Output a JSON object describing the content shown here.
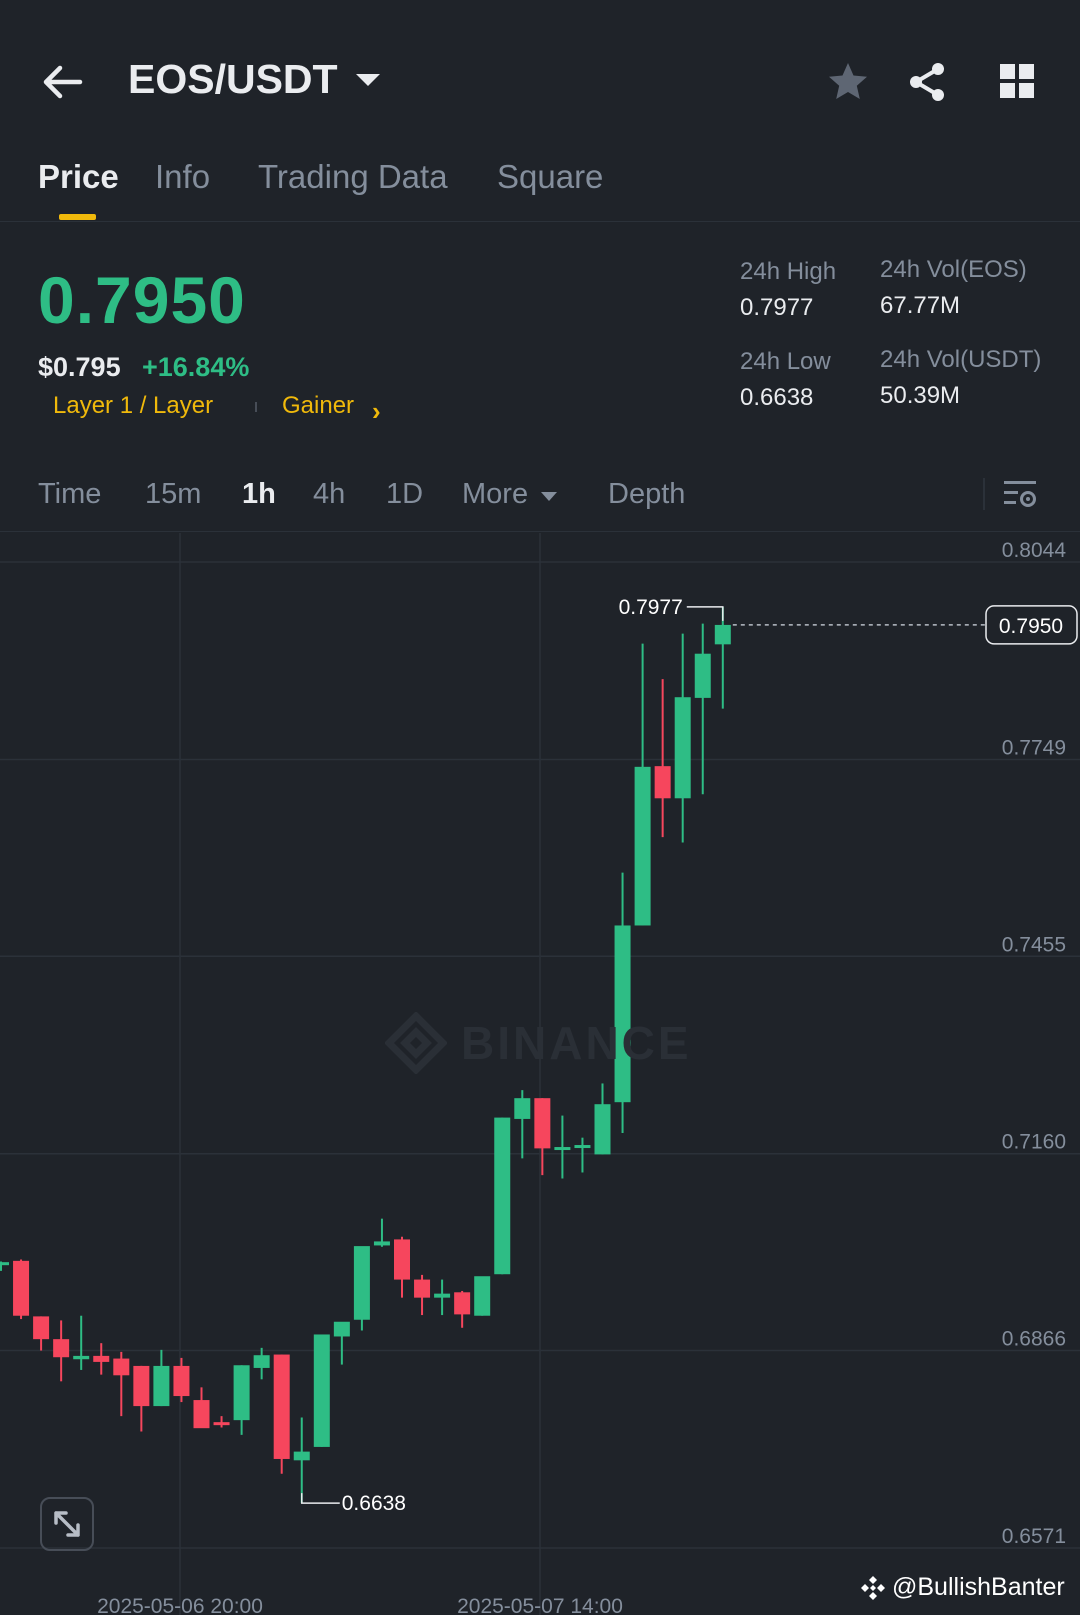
{
  "header": {
    "pair": "EOS/USDT"
  },
  "tabs": [
    {
      "label": "Price",
      "active": true
    },
    {
      "label": "Info",
      "active": false
    },
    {
      "label": "Trading Data",
      "active": false
    },
    {
      "label": "Square",
      "active": false
    }
  ],
  "ticker": {
    "last_price": "0.7950",
    "usd_price": "$0.795",
    "change_pct": "+16.84%",
    "tag_category": "Layer 1 / Layer",
    "tag_gainer": "Gainer",
    "high_label": "24h High",
    "high_value": "0.7977",
    "low_label": "24h Low",
    "low_value": "0.6638",
    "vol_base_label": "24h Vol(EOS)",
    "vol_base_value": "67.77M",
    "vol_quote_label": "24h Vol(USDT)",
    "vol_quote_value": "50.39M"
  },
  "intervals": {
    "time": "Time",
    "m15": "15m",
    "h1": "1h",
    "h4": "4h",
    "d1": "1D",
    "more": "More",
    "depth": "Depth",
    "active": "1h"
  },
  "colors": {
    "up": "#2ebd85",
    "down": "#f6465d",
    "accent": "#f0b90b",
    "background": "#1f2329"
  },
  "chart_data": {
    "type": "candlestick",
    "y_ticks": [
      "0.8044",
      "0.7749",
      "0.7455",
      "0.7160",
      "0.6866",
      "0.6571"
    ],
    "ylim": [
      0.6571,
      0.8044
    ],
    "x_ticks": [
      "2025-05-06 20:00",
      "2025-05-07 14:00"
    ],
    "last_price_label": "0.7950",
    "high_marker": "0.7977",
    "low_marker": "0.6638",
    "watermark": "BINANCE",
    "candles": [
      {
        "o": 0.6996,
        "h": 0.6999,
        "l": 0.6985,
        "c": 0.6998
      },
      {
        "o": 0.7,
        "h": 0.7002,
        "l": 0.6913,
        "c": 0.6918
      },
      {
        "o": 0.6917,
        "h": 0.6917,
        "l": 0.6866,
        "c": 0.6883
      },
      {
        "o": 0.6883,
        "h": 0.6911,
        "l": 0.682,
        "c": 0.6856
      },
      {
        "o": 0.6853,
        "h": 0.6918,
        "l": 0.6837,
        "c": 0.6858
      },
      {
        "o": 0.6858,
        "h": 0.6877,
        "l": 0.683,
        "c": 0.6849
      },
      {
        "o": 0.6854,
        "h": 0.6864,
        "l": 0.6768,
        "c": 0.6829
      },
      {
        "o": 0.6843,
        "h": 0.6843,
        "l": 0.6745,
        "c": 0.6783
      },
      {
        "o": 0.6783,
        "h": 0.6867,
        "l": 0.6783,
        "c": 0.6843
      },
      {
        "o": 0.6843,
        "h": 0.6855,
        "l": 0.6789,
        "c": 0.6798
      },
      {
        "o": 0.6792,
        "h": 0.6811,
        "l": 0.6751,
        "c": 0.675
      },
      {
        "o": 0.6759,
        "h": 0.6768,
        "l": 0.6751,
        "c": 0.6757
      },
      {
        "o": 0.6762,
        "h": 0.6844,
        "l": 0.674,
        "c": 0.6844
      },
      {
        "o": 0.684,
        "h": 0.687,
        "l": 0.6823,
        "c": 0.6859
      },
      {
        "o": 0.686,
        "h": 0.686,
        "l": 0.6682,
        "c": 0.6704
      },
      {
        "o": 0.6702,
        "h": 0.6766,
        "l": 0.6638,
        "c": 0.6715
      },
      {
        "o": 0.6722,
        "h": 0.689,
        "l": 0.6722,
        "c": 0.689
      },
      {
        "o": 0.6887,
        "h": 0.6908,
        "l": 0.6845,
        "c": 0.6909
      },
      {
        "o": 0.6912,
        "h": 0.7021,
        "l": 0.6896,
        "c": 0.7022
      },
      {
        "o": 0.7023,
        "h": 0.7063,
        "l": 0.7021,
        "c": 0.7029
      },
      {
        "o": 0.7032,
        "h": 0.7036,
        "l": 0.6945,
        "c": 0.6972
      },
      {
        "o": 0.6972,
        "h": 0.6979,
        "l": 0.6919,
        "c": 0.6945
      },
      {
        "o": 0.6945,
        "h": 0.6972,
        "l": 0.6919,
        "c": 0.6951
      },
      {
        "o": 0.6953,
        "h": 0.6955,
        "l": 0.69,
        "c": 0.692
      },
      {
        "o": 0.6918,
        "h": 0.6974,
        "l": 0.6918,
        "c": 0.6977
      },
      {
        "o": 0.698,
        "h": 0.7214,
        "l": 0.698,
        "c": 0.7214
      },
      {
        "o": 0.7212,
        "h": 0.7255,
        "l": 0.7153,
        "c": 0.7243
      },
      {
        "o": 0.7243,
        "h": 0.7243,
        "l": 0.7128,
        "c": 0.7168
      },
      {
        "o": 0.7167,
        "h": 0.7217,
        "l": 0.7123,
        "c": 0.717
      },
      {
        "o": 0.7171,
        "h": 0.7184,
        "l": 0.7132,
        "c": 0.7173
      },
      {
        "o": 0.7159,
        "h": 0.7265,
        "l": 0.7159,
        "c": 0.7234
      },
      {
        "o": 0.7237,
        "h": 0.758,
        "l": 0.7191,
        "c": 0.7501
      },
      {
        "o": 0.7501,
        "h": 0.7922,
        "l": 0.7501,
        "c": 0.7738
      },
      {
        "o": 0.7739,
        "h": 0.7869,
        "l": 0.7633,
        "c": 0.7691
      },
      {
        "o": 0.7691,
        "h": 0.7937,
        "l": 0.7625,
        "c": 0.7842
      },
      {
        "o": 0.7841,
        "h": 0.7952,
        "l": 0.7697,
        "c": 0.7907
      },
      {
        "o": 0.7921,
        "h": 0.7977,
        "l": 0.7825,
        "c": 0.795
      }
    ]
  },
  "credit": "@BullishBanter"
}
